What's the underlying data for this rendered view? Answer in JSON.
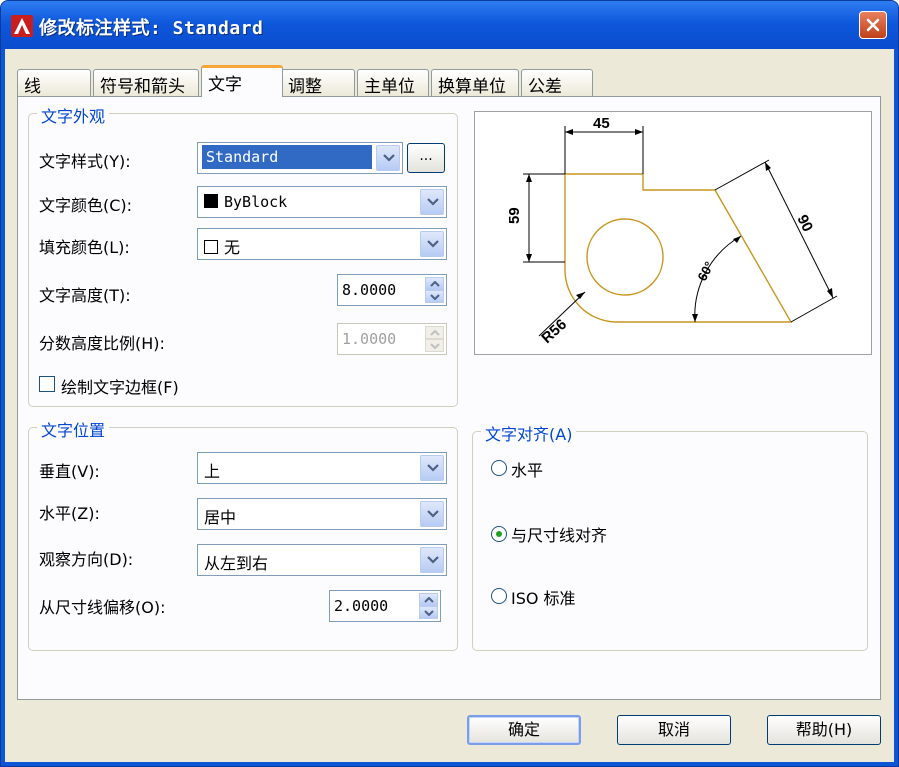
{
  "window": {
    "title": "修改标注样式: Standard",
    "app_icon": "autocad-icon",
    "close_icon": "close-icon",
    "colors": {
      "title_bar": "#0e58dc",
      "client": "#ece9d8",
      "group_title": "#0046d5",
      "selection": "#316ac5"
    }
  },
  "tabs": [
    {
      "label": "线"
    },
    {
      "label": "符号和箭头"
    },
    {
      "label": "文字",
      "active": true
    },
    {
      "label": "调整"
    },
    {
      "label": "主单位"
    },
    {
      "label": "换算单位"
    },
    {
      "label": "公差"
    }
  ],
  "text_appearance": {
    "title": "文字外观",
    "text_style": {
      "label": "文字样式(Y):",
      "value": "Standard",
      "browse_label": "..."
    },
    "text_color": {
      "label": "文字颜色(C):",
      "value": "ByBlock",
      "swatch_color": "#000000"
    },
    "fill_color": {
      "label": "填充颜色(L):",
      "value": "无",
      "swatch_color": "#ffffff"
    },
    "text_height": {
      "label": "文字高度(T):",
      "value": "8.0000"
    },
    "fraction_scale": {
      "label": "分数高度比例(H):",
      "value": "1.0000",
      "disabled": true
    },
    "draw_frame": {
      "label": "绘制文字边框(F)",
      "checked": false
    }
  },
  "text_placement": {
    "title": "文字位置",
    "vertical": {
      "label": "垂直(V):",
      "value": "上"
    },
    "horizontal": {
      "label": "水平(Z):",
      "value": "居中"
    },
    "view_direction": {
      "label": "观察方向(D):",
      "value": "从左到右"
    },
    "offset": {
      "label": "从尺寸线偏移(O):",
      "value": "2.0000"
    }
  },
  "text_alignment": {
    "title": "文字对齐(A)",
    "options": [
      {
        "label": "水平",
        "checked": false
      },
      {
        "label": "与尺寸线对齐",
        "checked": true
      },
      {
        "label": "ISO 标准",
        "checked": false
      }
    ]
  },
  "preview": {
    "dim_top": "45",
    "dim_left": "59",
    "dim_slant": "90",
    "dim_angle": "60°",
    "dim_radius": "R56",
    "colors": {
      "outline": "#c8961e",
      "dims": "#000000"
    }
  },
  "buttons": {
    "ok": "确定",
    "cancel": "取消",
    "help": "帮助(H)"
  }
}
